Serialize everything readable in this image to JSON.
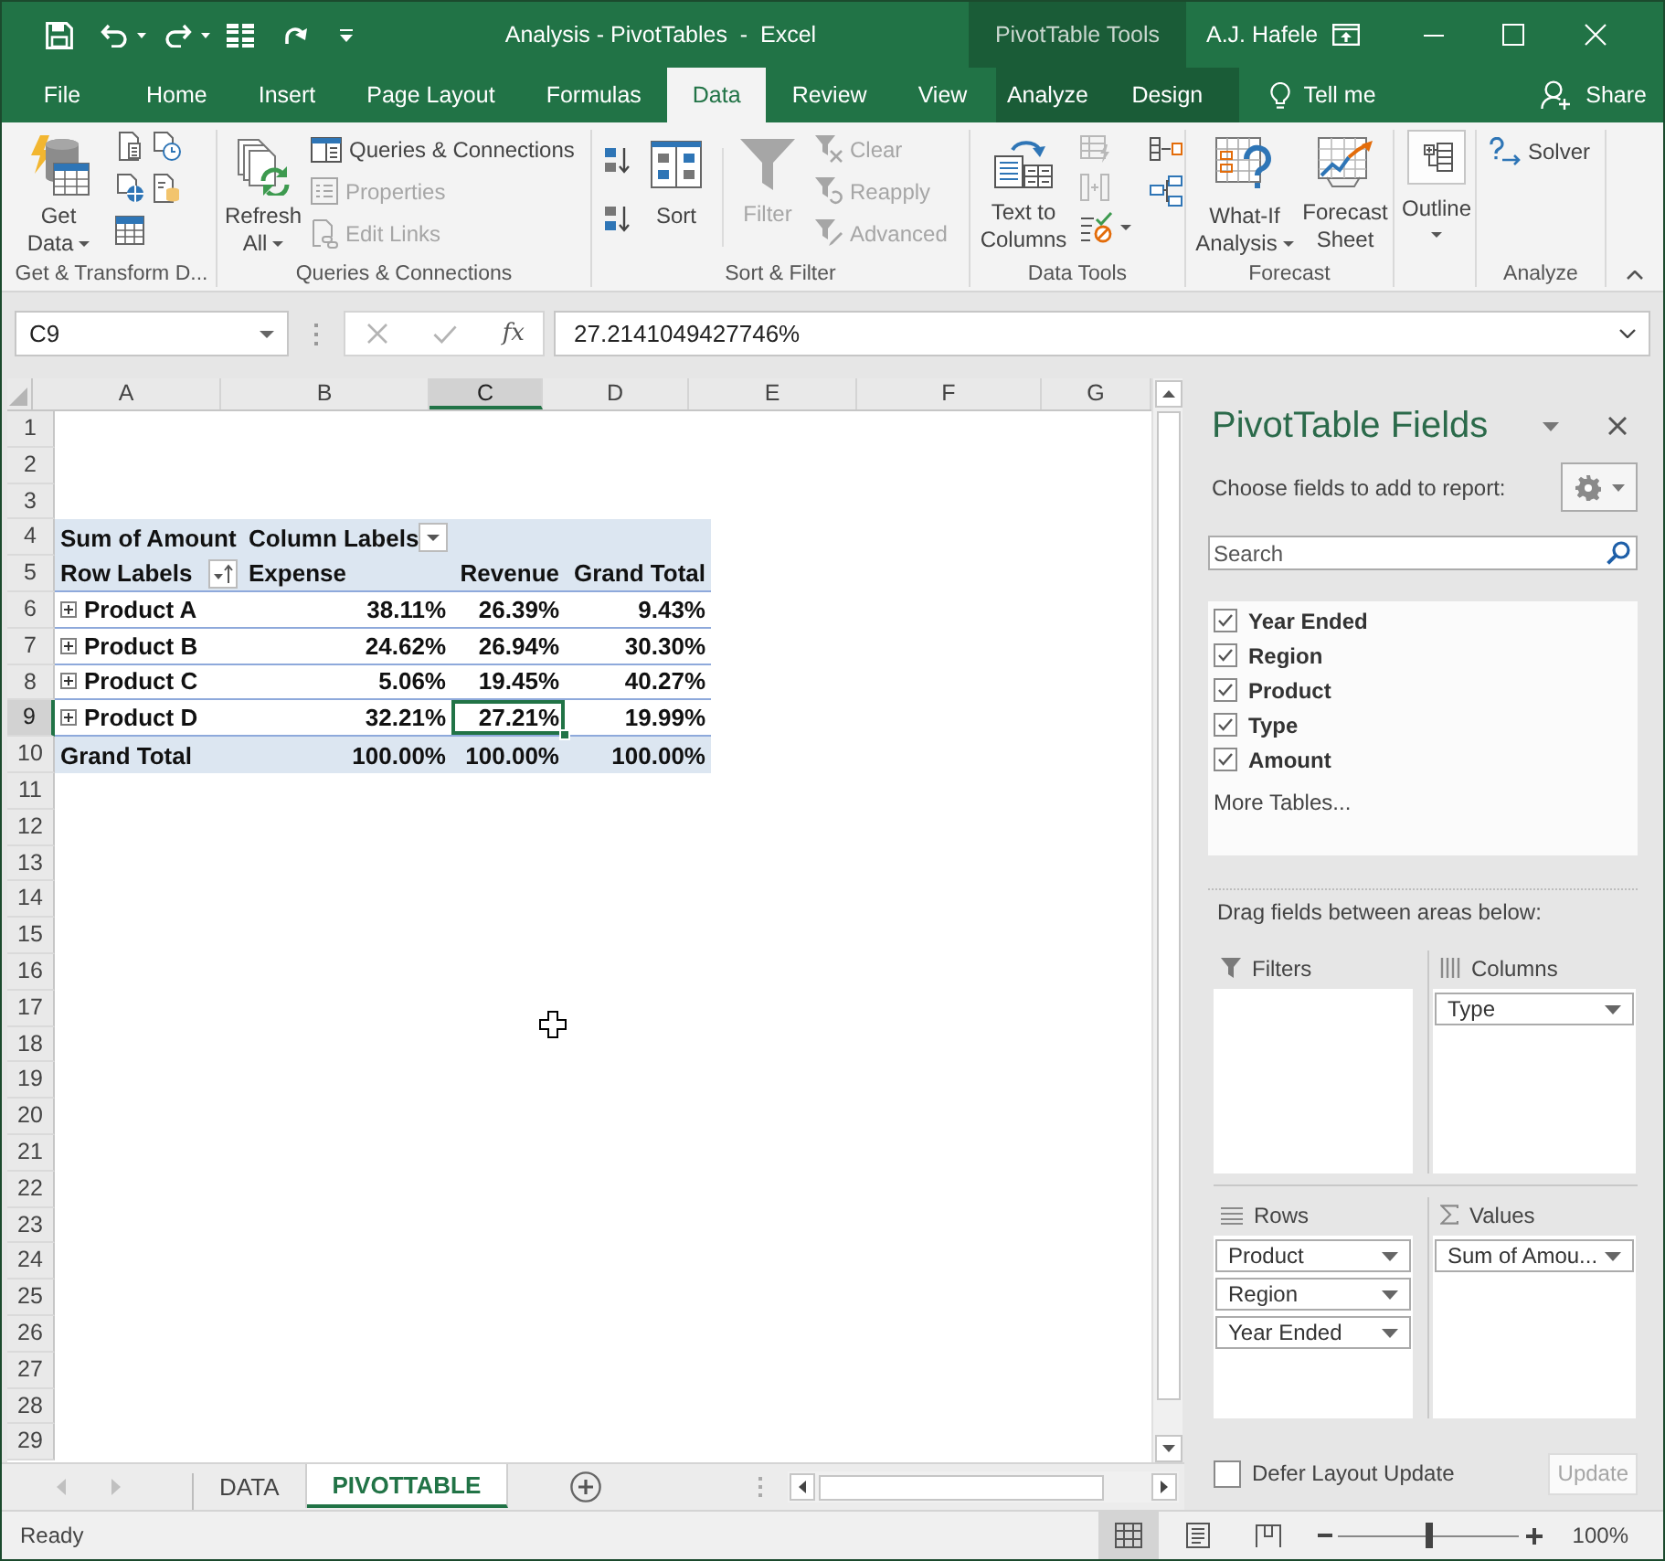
{
  "title_bar": {
    "title": "Analysis - PivotTables  -  Excel",
    "context_tools": "PivotTable Tools",
    "user": "A.J. Hafele"
  },
  "ribbon_tabs": [
    {
      "label": "File",
      "kind": "standard",
      "selected": false
    },
    {
      "label": "Home",
      "kind": "standard",
      "selected": false
    },
    {
      "label": "Insert",
      "kind": "standard",
      "selected": false
    },
    {
      "label": "Page Layout",
      "kind": "standard",
      "selected": false
    },
    {
      "label": "Formulas",
      "kind": "standard",
      "selected": false
    },
    {
      "label": "Data",
      "kind": "standard",
      "selected": true
    },
    {
      "label": "Review",
      "kind": "standard",
      "selected": false
    },
    {
      "label": "View",
      "kind": "standard",
      "selected": false
    },
    {
      "label": "Analyze",
      "kind": "contextual",
      "selected": false
    },
    {
      "label": "Design",
      "kind": "contextual",
      "selected": false
    }
  ],
  "tell_me": "Tell me",
  "share": "Share",
  "ribbon_groups": [
    {
      "label": "Get & Transform D...",
      "buttons": [
        {
          "label": "Get Data",
          "disabled": false,
          "dropdown": true
        }
      ]
    },
    {
      "label": "Queries & Connections",
      "buttons": [
        {
          "label": "Refresh All",
          "disabled": false,
          "dropdown": true
        },
        {
          "label": "Queries & Connections",
          "disabled": false
        },
        {
          "label": "Properties",
          "disabled": true
        },
        {
          "label": "Edit Links",
          "disabled": true
        }
      ]
    },
    {
      "label": "Sort & Filter",
      "buttons": [
        {
          "label": "Sort",
          "disabled": false
        },
        {
          "label": "Filter",
          "disabled": true
        },
        {
          "label": "Clear",
          "disabled": true
        },
        {
          "label": "Reapply",
          "disabled": true
        },
        {
          "label": "Advanced",
          "disabled": true
        }
      ]
    },
    {
      "label": "Data Tools",
      "buttons": [
        {
          "label": "Text to Columns",
          "disabled": false
        }
      ],
      "icon_buttons": [
        {
          "disabled": true
        },
        {
          "disabled": true
        },
        {
          "disabled": false,
          "dropdown": true
        },
        {
          "disabled": false
        },
        {
          "disabled": false
        }
      ]
    },
    {
      "label": "Forecast",
      "buttons": [
        {
          "label": "What-If Analysis",
          "disabled": false,
          "dropdown": true
        },
        {
          "label": "Forecast Sheet",
          "disabled": false
        }
      ]
    },
    {
      "buttons": [
        {
          "label": "Outline",
          "disabled": false,
          "dropdown": true
        }
      ]
    },
    {
      "label": "Analyze",
      "buttons": [
        {
          "label": "Solver",
          "disabled": false
        }
      ]
    }
  ],
  "formula_bar": {
    "name_box": "C9",
    "function_symbol": "fx",
    "formula": "27.2141049427746%"
  },
  "sheet": {
    "columns": [
      {
        "label": "A",
        "selected": false
      },
      {
        "label": "B",
        "selected": false
      },
      {
        "label": "C",
        "selected": true
      },
      {
        "label": "D",
        "selected": false
      },
      {
        "label": "E",
        "selected": false
      },
      {
        "label": "F",
        "selected": false
      },
      {
        "label": "G",
        "selected": false
      }
    ],
    "rows": [
      {
        "label": "1",
        "selected": false
      },
      {
        "label": "2",
        "selected": false
      },
      {
        "label": "3",
        "selected": false
      },
      {
        "label": "4",
        "selected": false
      },
      {
        "label": "5",
        "selected": false
      },
      {
        "label": "6",
        "selected": false
      },
      {
        "label": "7",
        "selected": false
      },
      {
        "label": "8",
        "selected": false
      },
      {
        "label": "9",
        "selected": true
      },
      {
        "label": "10",
        "selected": false
      },
      {
        "label": "11",
        "selected": false
      },
      {
        "label": "12",
        "selected": false
      },
      {
        "label": "13",
        "selected": false
      },
      {
        "label": "14",
        "selected": false
      },
      {
        "label": "15",
        "selected": false
      },
      {
        "label": "16",
        "selected": false
      },
      {
        "label": "17",
        "selected": false
      },
      {
        "label": "18",
        "selected": false
      },
      {
        "label": "19",
        "selected": false
      },
      {
        "label": "20",
        "selected": false
      },
      {
        "label": "21",
        "selected": false
      },
      {
        "label": "22",
        "selected": false
      },
      {
        "label": "23",
        "selected": false
      },
      {
        "label": "24",
        "selected": false
      },
      {
        "label": "25",
        "selected": false
      },
      {
        "label": "26",
        "selected": false
      },
      {
        "label": "27",
        "selected": false
      },
      {
        "label": "28",
        "selected": false
      },
      {
        "label": "29",
        "selected": false
      }
    ]
  },
  "pivot_table": {
    "value_field": "Sum of Amount",
    "column_labels": "Column Labels",
    "row_labels": "Row Labels",
    "columns": [
      "Expense",
      "Revenue",
      "Grand Total"
    ],
    "items": [
      {
        "label": "Product A",
        "values": [
          {
            "text": "38.11%",
            "selected": false
          },
          {
            "text": "26.39%",
            "selected": false
          },
          {
            "text": "9.43%",
            "selected": false
          }
        ]
      },
      {
        "label": "Product B",
        "values": [
          {
            "text": "24.62%",
            "selected": false
          },
          {
            "text": "26.94%",
            "selected": false
          },
          {
            "text": "30.30%",
            "selected": false
          }
        ]
      },
      {
        "label": "Product C",
        "values": [
          {
            "text": "5.06%",
            "selected": false
          },
          {
            "text": "19.45%",
            "selected": false
          },
          {
            "text": "40.27%",
            "selected": false
          }
        ]
      },
      {
        "label": "Product D",
        "values": [
          {
            "text": "32.21%",
            "selected": false
          },
          {
            "text": "27.21%",
            "selected": true
          },
          {
            "text": "19.99%",
            "selected": false
          }
        ]
      }
    ],
    "total": {
      "label": "Grand Total",
      "values": [
        {
          "text": "100.00%",
          "selected": false
        },
        {
          "text": "100.00%",
          "selected": false
        },
        {
          "text": "100.00%",
          "selected": false
        }
      ]
    }
  },
  "sheet_tabs": [
    {
      "label": "DATA",
      "selected": false
    },
    {
      "label": "PIVOTTABLE",
      "selected": true
    }
  ],
  "pivot_fields_pane": {
    "title": "PivotTable Fields",
    "instruction": "Choose fields to add to report:",
    "search": {
      "placeholder": "Search"
    },
    "fields": [
      {
        "label": "Year Ended",
        "checked": true
      },
      {
        "label": "Region",
        "checked": true
      },
      {
        "label": "Product",
        "checked": true
      },
      {
        "label": "Type",
        "checked": true
      },
      {
        "label": "Amount",
        "checked": true
      }
    ],
    "more_tables": "More Tables...",
    "areas_hint": "Drag fields between areas below:",
    "areas": [
      {
        "label": "Filters",
        "kind": "filters"
      },
      {
        "label": "Columns",
        "kind": "columns",
        "items": [
          {
            "label": "Type"
          }
        ]
      },
      {
        "label": "Rows",
        "kind": "rows",
        "items": [
          {
            "label": "Product"
          },
          {
            "label": "Region"
          },
          {
            "label": "Year Ended"
          }
        ]
      },
      {
        "label": "Values",
        "kind": "values",
        "items": [
          {
            "label": "Sum of Amou..."
          }
        ]
      }
    ],
    "defer_update": {
      "label": "Defer Layout Update",
      "checked": false
    },
    "update_button": {
      "label": "Update",
      "disabled": true
    }
  },
  "status_bar": {
    "status": "Ready",
    "view_buttons": [
      {
        "selected": true
      },
      {
        "selected": false
      },
      {
        "selected": false
      }
    ],
    "zoom": {
      "level": 0.5,
      "label": "100%"
    }
  }
}
